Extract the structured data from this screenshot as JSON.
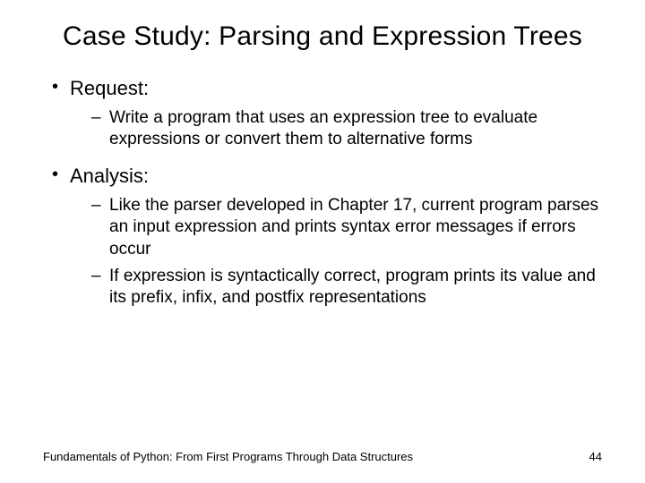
{
  "title": "Case Study: Parsing and Expression Trees",
  "bullets": [
    {
      "label": "Request:",
      "subs": [
        "Write a program that uses an expression tree to evaluate expressions or convert them to alternative forms"
      ]
    },
    {
      "label": "Analysis:",
      "subs": [
        "Like the parser developed in Chapter 17, current program parses an input expression and prints syntax error messages if errors occur",
        "If expression is syntactically correct, program prints its value and its prefix, infix, and postfix representations"
      ]
    }
  ],
  "footer": {
    "source": "Fundamentals of Python: From First Programs Through Data Structures",
    "page": "44"
  }
}
